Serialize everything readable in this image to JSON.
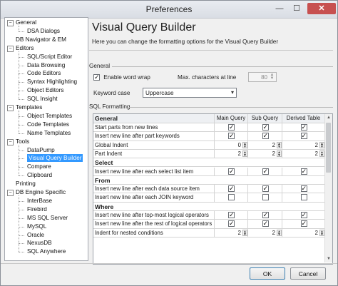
{
  "window": {
    "title": "Preferences",
    "min_glyph": "—",
    "max_glyph": "☐",
    "close_glyph": "✕"
  },
  "tree": {
    "items": [
      {
        "label": "General",
        "indent": 0,
        "expander": "−"
      },
      {
        "label": "DSA Dialogs",
        "indent": 1
      },
      {
        "label": "DB Navigator & EM",
        "indent": 0
      },
      {
        "label": "Editors",
        "indent": 0,
        "expander": "−"
      },
      {
        "label": "SQL/Script Editor",
        "indent": 1
      },
      {
        "label": "Data Browsing",
        "indent": 1
      },
      {
        "label": "Code Editors",
        "indent": 1
      },
      {
        "label": "Syntax Highlighting",
        "indent": 1
      },
      {
        "label": "Object Editors",
        "indent": 1
      },
      {
        "label": "SQL Insight",
        "indent": 1
      },
      {
        "label": "Templates",
        "indent": 0,
        "expander": "−"
      },
      {
        "label": "Object Templates",
        "indent": 1
      },
      {
        "label": "Code Templates",
        "indent": 1
      },
      {
        "label": "Name Templates",
        "indent": 1
      },
      {
        "label": "Tools",
        "indent": 0,
        "expander": "−"
      },
      {
        "label": "DataPump",
        "indent": 1
      },
      {
        "label": "Visual Query Builder",
        "indent": 1,
        "selected": true
      },
      {
        "label": "Compare",
        "indent": 1
      },
      {
        "label": "Clipboard",
        "indent": 1
      },
      {
        "label": "Printing",
        "indent": 0
      },
      {
        "label": "DB Engine Specific",
        "indent": 0,
        "expander": "−"
      },
      {
        "label": "InterBase",
        "indent": 1
      },
      {
        "label": "Firebird",
        "indent": 1
      },
      {
        "label": "MS SQL Server",
        "indent": 1
      },
      {
        "label": "MySQL",
        "indent": 1
      },
      {
        "label": "Oracle",
        "indent": 1
      },
      {
        "label": "NexusDB",
        "indent": 1
      },
      {
        "label": "SQL Anywhere",
        "indent": 1
      }
    ]
  },
  "page": {
    "heading": "Visual Query Builder",
    "description": "Here you can change the formatting options for the Visual Query Builder"
  },
  "general": {
    "section_label": "General",
    "word_wrap_label": "Enable word wrap",
    "word_wrap_checked": true,
    "max_chars_label": "Max. characters at line",
    "max_chars_value": "80",
    "keyword_case_label": "Keyword case",
    "keyword_case_value": "Uppercase"
  },
  "sql_formatting": {
    "section_label": "SQL Formatting",
    "columns": [
      "General",
      "Main Query",
      "Sub Query",
      "Derived Table"
    ],
    "rows": [
      {
        "type": "row",
        "label": "Start parts from new lines",
        "cells": [
          {
            "kind": "check",
            "on": true
          },
          {
            "kind": "check",
            "on": true
          },
          {
            "kind": "check",
            "on": true
          }
        ]
      },
      {
        "type": "row",
        "label": "Insert new line after part keywords",
        "cells": [
          {
            "kind": "check",
            "on": true
          },
          {
            "kind": "check",
            "on": true
          },
          {
            "kind": "check",
            "on": true
          }
        ]
      },
      {
        "type": "row",
        "label": "Global Indent",
        "cells": [
          {
            "kind": "spin",
            "value": "0"
          },
          {
            "kind": "spin",
            "value": "2"
          },
          {
            "kind": "spin",
            "value": "2"
          }
        ]
      },
      {
        "type": "row",
        "label": "Part Indent",
        "cells": [
          {
            "kind": "spin",
            "value": "2"
          },
          {
            "kind": "spin",
            "value": "2"
          },
          {
            "kind": "spin",
            "value": "2"
          }
        ]
      },
      {
        "type": "group",
        "label": "Select"
      },
      {
        "type": "row",
        "label": "Insert new line after each select list item",
        "cells": [
          {
            "kind": "check",
            "on": true
          },
          {
            "kind": "check",
            "on": true
          },
          {
            "kind": "check",
            "on": true
          }
        ]
      },
      {
        "type": "group",
        "label": "From"
      },
      {
        "type": "row",
        "label": "Insert new line after each data source item",
        "cells": [
          {
            "kind": "check",
            "on": true
          },
          {
            "kind": "check",
            "on": true
          },
          {
            "kind": "check",
            "on": true
          }
        ]
      },
      {
        "type": "row",
        "label": "Insert new line after each JOIN keyword",
        "cells": [
          {
            "kind": "check",
            "on": false
          },
          {
            "kind": "check",
            "on": false
          },
          {
            "kind": "check",
            "on": false
          }
        ]
      },
      {
        "type": "group",
        "label": "Where"
      },
      {
        "type": "row",
        "label": "Insert new line after top-most logical operators",
        "cells": [
          {
            "kind": "check",
            "on": true
          },
          {
            "kind": "check",
            "on": true
          },
          {
            "kind": "check",
            "on": true
          }
        ]
      },
      {
        "type": "row",
        "label": "Insert new line after the rest of logical operators",
        "cells": [
          {
            "kind": "check",
            "on": true
          },
          {
            "kind": "check",
            "on": true
          },
          {
            "kind": "check",
            "on": true
          }
        ]
      },
      {
        "type": "row",
        "label": "Indent for nested conditions",
        "cells": [
          {
            "kind": "spin",
            "value": "2"
          },
          {
            "kind": "spin",
            "value": "2"
          },
          {
            "kind": "spin",
            "value": "2"
          }
        ]
      }
    ]
  },
  "buttons": {
    "ok": "OK",
    "cancel": "Cancel"
  },
  "watermark": "SOFTPEDIA"
}
